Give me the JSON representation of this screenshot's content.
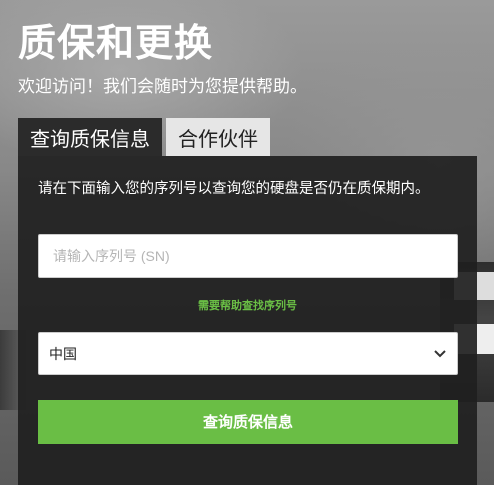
{
  "hero": {
    "title": "质保和更换",
    "subtitle": "欢迎访问！我们会随时为您提供帮助。"
  },
  "tabs": [
    {
      "label": "查询质保信息",
      "active": true
    },
    {
      "label": "合作伙伴",
      "active": false
    }
  ],
  "form": {
    "intro": "请在下面输入您的序列号以查询您的硬盘是否仍在质保期内。",
    "sn_placeholder": "请输入序列号 (SN)",
    "sn_value": "",
    "help_link": "需要帮助查找序列号",
    "country_value": "中国",
    "submit_label": "查询质保信息"
  },
  "colors": {
    "accent": "#6abe45",
    "panel": "#202020",
    "tab_active": "#2b2b2b",
    "tab_inactive": "#e6e6e6"
  },
  "icons": {
    "select_chevron": "chevron-down-icon"
  }
}
